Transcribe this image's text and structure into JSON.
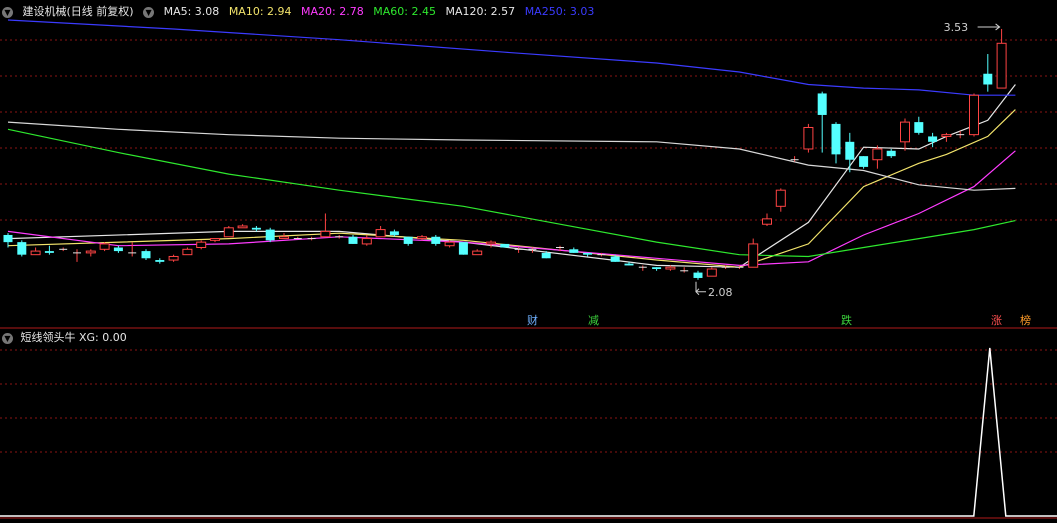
{
  "header": {
    "title": "建设机械(日线 前复权)",
    "ma_items": [
      {
        "label": "MA5: 3.08",
        "color": "#e6e6e6"
      },
      {
        "label": "MA10: 2.94",
        "color": "#f2e36b"
      },
      {
        "label": "MA20: 2.78",
        "color": "#ff3cff"
      },
      {
        "label": "MA60: 2.45",
        "color": "#2ee82e"
      },
      {
        "label": "MA120: 2.57",
        "color": "#e6e6e6"
      },
      {
        "label": "MA250: 3.03",
        "color": "#3b3bff"
      }
    ]
  },
  "indicator": {
    "title": "短线领头牛",
    "xg_label": "XG: 0.00"
  },
  "annotations": {
    "high_label": "3.53",
    "low_label": "2.08"
  },
  "event_tags": [
    {
      "text": "财",
      "color": "#6fb0ff"
    },
    {
      "text": "减",
      "color": "#3cd23c"
    },
    {
      "text": "跌",
      "color": "#3cd23c"
    },
    {
      "text": "涨",
      "color": "#ff5050"
    },
    {
      "text": "榜",
      "color": "#ff9c2a"
    }
  ],
  "colors": {
    "up": "#ff4444",
    "down": "#54ffff",
    "grid": "#8a1414",
    "background": "#000000"
  },
  "chart_data": {
    "type": "candlestick",
    "price_range": [
      1.95,
      3.58
    ],
    "candles": [
      [
        2.38,
        2.34,
        2.39,
        2.31
      ],
      [
        2.34,
        2.27,
        2.35,
        2.26
      ],
      [
        2.27,
        2.29,
        2.31,
        2.27
      ],
      [
        2.29,
        2.28,
        2.32,
        2.27
      ],
      [
        2.3,
        2.3,
        2.31,
        2.29
      ],
      [
        2.28,
        2.28,
        2.3,
        2.23
      ],
      [
        2.28,
        2.29,
        2.3,
        2.26
      ],
      [
        2.3,
        2.33,
        2.34,
        2.29
      ],
      [
        2.31,
        2.29,
        2.32,
        2.28
      ],
      [
        2.28,
        2.28,
        2.34,
        2.26
      ],
      [
        2.29,
        2.25,
        2.3,
        2.24
      ],
      [
        2.24,
        2.23,
        2.25,
        2.22
      ],
      [
        2.24,
        2.26,
        2.27,
        2.23
      ],
      [
        2.27,
        2.3,
        2.31,
        2.27
      ],
      [
        2.31,
        2.34,
        2.35,
        2.3
      ],
      [
        2.35,
        2.36,
        2.36,
        2.34
      ],
      [
        2.37,
        2.42,
        2.43,
        2.37
      ],
      [
        2.42,
        2.43,
        2.44,
        2.42
      ],
      [
        2.42,
        2.41,
        2.43,
        2.4
      ],
      [
        2.41,
        2.35,
        2.42,
        2.34
      ],
      [
        2.36,
        2.37,
        2.39,
        2.36
      ],
      [
        2.36,
        2.36,
        2.37,
        2.36
      ],
      [
        2.36,
        2.36,
        2.37,
        2.35
      ],
      [
        2.37,
        2.4,
        2.5,
        2.37
      ],
      [
        2.37,
        2.37,
        2.38,
        2.36
      ],
      [
        2.37,
        2.33,
        2.38,
        2.33
      ],
      [
        2.33,
        2.36,
        2.38,
        2.32
      ],
      [
        2.37,
        2.41,
        2.43,
        2.37
      ],
      [
        2.4,
        2.38,
        2.41,
        2.37
      ],
      [
        2.37,
        2.33,
        2.37,
        2.32
      ],
      [
        2.36,
        2.37,
        2.38,
        2.35
      ],
      [
        2.37,
        2.33,
        2.38,
        2.32
      ],
      [
        2.32,
        2.34,
        2.35,
        2.31
      ],
      [
        2.34,
        2.27,
        2.34,
        2.27
      ],
      [
        2.27,
        2.29,
        2.3,
        2.28
      ],
      [
        2.33,
        2.34,
        2.35,
        2.31
      ],
      [
        2.33,
        2.31,
        2.33,
        2.31
      ],
      [
        2.3,
        2.3,
        2.31,
        2.28
      ],
      [
        2.3,
        2.3,
        2.31,
        2.28
      ],
      [
        2.28,
        2.25,
        2.29,
        2.25
      ],
      [
        2.31,
        2.31,
        2.32,
        2.29
      ],
      [
        2.3,
        2.28,
        2.31,
        2.28
      ],
      [
        2.28,
        2.27,
        2.28,
        2.26
      ],
      [
        2.27,
        2.27,
        2.28,
        2.26
      ],
      [
        2.26,
        2.23,
        2.27,
        2.23
      ],
      [
        2.22,
        2.21,
        2.23,
        2.21
      ],
      [
        2.2,
        2.2,
        2.21,
        2.18
      ],
      [
        2.2,
        2.19,
        2.2,
        2.18
      ],
      [
        2.19,
        2.2,
        2.21,
        2.18
      ],
      [
        2.18,
        2.18,
        2.2,
        2.17
      ],
      [
        2.17,
        2.14,
        2.18,
        2.13
      ],
      [
        2.15,
        2.19,
        2.2,
        2.15
      ],
      [
        2.2,
        2.2,
        2.21,
        2.19
      ],
      [
        2.2,
        2.2,
        2.21,
        2.19
      ],
      [
        2.2,
        2.33,
        2.36,
        2.2
      ],
      [
        2.44,
        2.47,
        2.5,
        2.43
      ],
      [
        2.54,
        2.63,
        2.64,
        2.51
      ],
      [
        2.8,
        2.8,
        2.82,
        2.79
      ],
      [
        2.86,
        2.98,
        3.0,
        2.84
      ],
      [
        3.17,
        3.05,
        3.18,
        2.84
      ],
      [
        3.0,
        2.83,
        3.01,
        2.78
      ],
      [
        2.9,
        2.8,
        2.95,
        2.73
      ],
      [
        2.82,
        2.76,
        2.82,
        2.75
      ],
      [
        2.8,
        2.86,
        2.88,
        2.75
      ],
      [
        2.85,
        2.82,
        2.86,
        2.81
      ],
      [
        2.9,
        3.01,
        3.03,
        2.85
      ],
      [
        3.01,
        2.95,
        3.04,
        2.94
      ],
      [
        2.93,
        2.9,
        2.95,
        2.87
      ],
      [
        2.93,
        2.94,
        2.95,
        2.9
      ],
      [
        2.94,
        2.94,
        2.96,
        2.92
      ],
      [
        2.94,
        3.16,
        3.17,
        2.93
      ],
      [
        3.28,
        3.22,
        3.39,
        3.18
      ],
      [
        3.2,
        3.45,
        3.53,
        3.2
      ]
    ],
    "ma_lines": [
      {
        "name": "MA5",
        "color": "#e6e6e6",
        "values": [
          [
            0,
            2.36
          ],
          [
            16,
            2.4
          ],
          [
            24,
            2.4
          ],
          [
            33,
            2.34
          ],
          [
            47,
            2.21
          ],
          [
            53,
            2.2
          ],
          [
            58,
            2.45
          ],
          [
            62,
            2.87
          ],
          [
            66,
            2.86
          ],
          [
            68,
            2.93
          ],
          [
            71,
            3.02
          ],
          [
            73,
            3.22
          ]
        ]
      },
      {
        "name": "MA10",
        "color": "#f2e36b",
        "values": [
          [
            0,
            2.32
          ],
          [
            16,
            2.36
          ],
          [
            24,
            2.39
          ],
          [
            33,
            2.35
          ],
          [
            47,
            2.24
          ],
          [
            53,
            2.2
          ],
          [
            58,
            2.33
          ],
          [
            62,
            2.65
          ],
          [
            66,
            2.78
          ],
          [
            68,
            2.83
          ],
          [
            71,
            2.93
          ],
          [
            73,
            3.08
          ]
        ]
      },
      {
        "name": "MA20",
        "color": "#ff3cff",
        "values": [
          [
            0,
            2.4
          ],
          [
            8,
            2.32
          ],
          [
            16,
            2.33
          ],
          [
            24,
            2.37
          ],
          [
            33,
            2.34
          ],
          [
            47,
            2.25
          ],
          [
            53,
            2.21
          ],
          [
            58,
            2.23
          ],
          [
            62,
            2.38
          ],
          [
            66,
            2.5
          ],
          [
            70,
            2.65
          ],
          [
            73,
            2.85
          ]
        ]
      },
      {
        "name": "MA60",
        "color": "#2ee82e",
        "values": [
          [
            0,
            2.97
          ],
          [
            8,
            2.84
          ],
          [
            16,
            2.72
          ],
          [
            24,
            2.63
          ],
          [
            33,
            2.54
          ],
          [
            47,
            2.34
          ],
          [
            53,
            2.27
          ],
          [
            58,
            2.26
          ],
          [
            62,
            2.31
          ],
          [
            66,
            2.36
          ],
          [
            70,
            2.41
          ],
          [
            73,
            2.46
          ]
        ]
      },
      {
        "name": "MA120",
        "color": "#d8d8d8",
        "values": [
          [
            0,
            3.01
          ],
          [
            8,
            2.97
          ],
          [
            16,
            2.94
          ],
          [
            24,
            2.92
          ],
          [
            33,
            2.91
          ],
          [
            47,
            2.9
          ],
          [
            53,
            2.86
          ],
          [
            58,
            2.77
          ],
          [
            62,
            2.74
          ],
          [
            66,
            2.66
          ],
          [
            70,
            2.63
          ],
          [
            73,
            2.64
          ]
        ]
      },
      {
        "name": "MA250",
        "color": "#3b3bff",
        "values": [
          [
            0,
            3.58
          ],
          [
            12,
            3.53
          ],
          [
            24,
            3.47
          ],
          [
            36,
            3.4
          ],
          [
            47,
            3.34
          ],
          [
            53,
            3.29
          ],
          [
            58,
            3.22
          ],
          [
            62,
            3.2
          ],
          [
            66,
            3.19
          ],
          [
            70,
            3.16
          ],
          [
            73,
            3.16
          ]
        ]
      }
    ],
    "xg_series": {
      "spike_index": 71,
      "spike_value": 1,
      "baseline": 0
    }
  }
}
